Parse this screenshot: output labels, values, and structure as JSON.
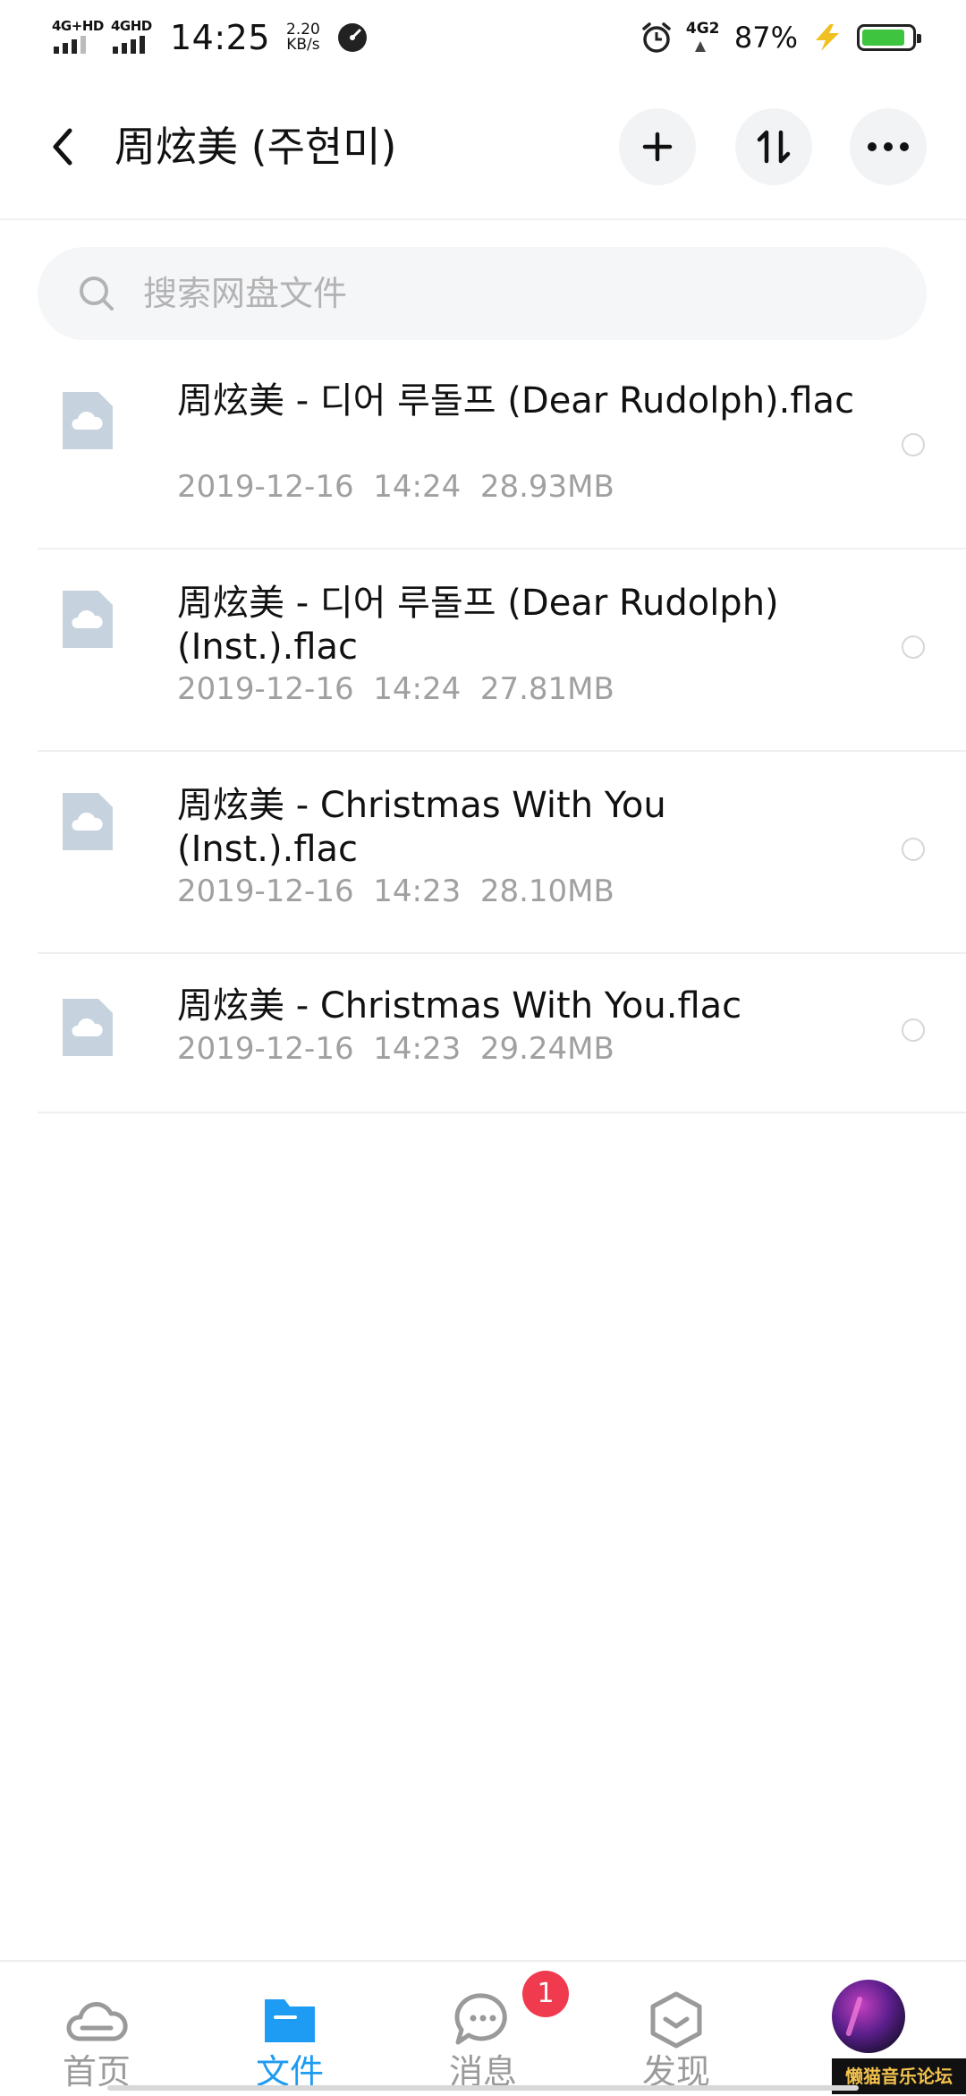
{
  "status_bar": {
    "network1": "4G+HD",
    "network2": "4GHD",
    "time": "14:25",
    "speed_value": "2.20",
    "speed_unit": "KB/s",
    "network3": "4G2",
    "battery_percent": "87%",
    "battery_level": 0.87
  },
  "header": {
    "title": "周炫美 (주현미)"
  },
  "search": {
    "placeholder": "搜索网盘文件"
  },
  "files": [
    {
      "name": "周炫美 - 디어 루돌프 (Dear Rudolph).flac",
      "date": "2019-12-16",
      "time": "14:24",
      "size": "28.93MB"
    },
    {
      "name": "周炫美 - 디어 루돌프 (Dear Rudolph) (Inst.).flac",
      "date": "2019-12-16",
      "time": "14:24",
      "size": "27.81MB"
    },
    {
      "name": "周炫美 - Christmas With You (Inst.).flac",
      "date": "2019-12-16",
      "time": "14:23",
      "size": "28.10MB"
    },
    {
      "name": "周炫美 - Christmas With You.flac",
      "date": "2019-12-16",
      "time": "14:23",
      "size": "29.24MB"
    }
  ],
  "bottom_nav": {
    "items": [
      {
        "label": "首页",
        "icon": "cloud-icon"
      },
      {
        "label": "文件",
        "icon": "folder-icon",
        "active": true
      },
      {
        "label": "消息",
        "icon": "chat-icon",
        "badge": "1"
      },
      {
        "label": "发现",
        "icon": "discover-icon"
      }
    ]
  },
  "watermark": "懒猫音乐论坛",
  "colors": {
    "accent": "#1e9bf2",
    "badge": "#f03a4e",
    "file_icon": "#c6d3de"
  }
}
